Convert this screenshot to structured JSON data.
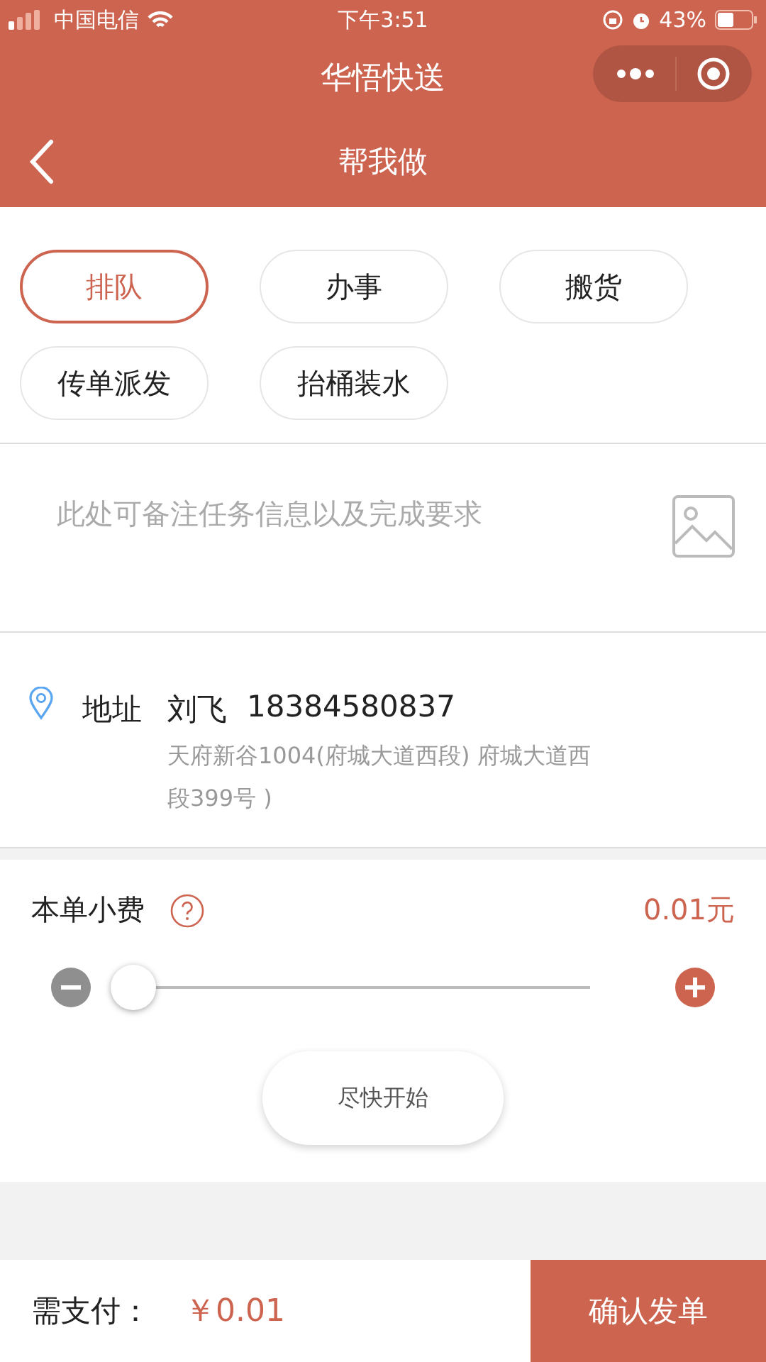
{
  "status_bar": {
    "carrier": "中国电信",
    "time": "下午3:51",
    "battery": "43%"
  },
  "app_title": "华悟快送",
  "page_title": "帮我做",
  "tags": [
    {
      "label": "排队",
      "selected": true
    },
    {
      "label": "办事",
      "selected": false
    },
    {
      "label": "搬货",
      "selected": false
    },
    {
      "label": "传单派发",
      "selected": false
    },
    {
      "label": "抬桶装水",
      "selected": false
    }
  ],
  "note": {
    "placeholder": "此处可备注任务信息以及完成要求"
  },
  "address": {
    "label": "地址",
    "name": "刘飞",
    "phone": "18384580837",
    "detail": "天府新谷1004(府城大道西段) 府城大道西段399号 )"
  },
  "fee": {
    "label": "本单小费",
    "amount": "0.01元",
    "level": 0
  },
  "start_button": "尽快开始",
  "bottom": {
    "label": "需支付：",
    "amount": "￥0.01",
    "confirm": "确认发单"
  }
}
